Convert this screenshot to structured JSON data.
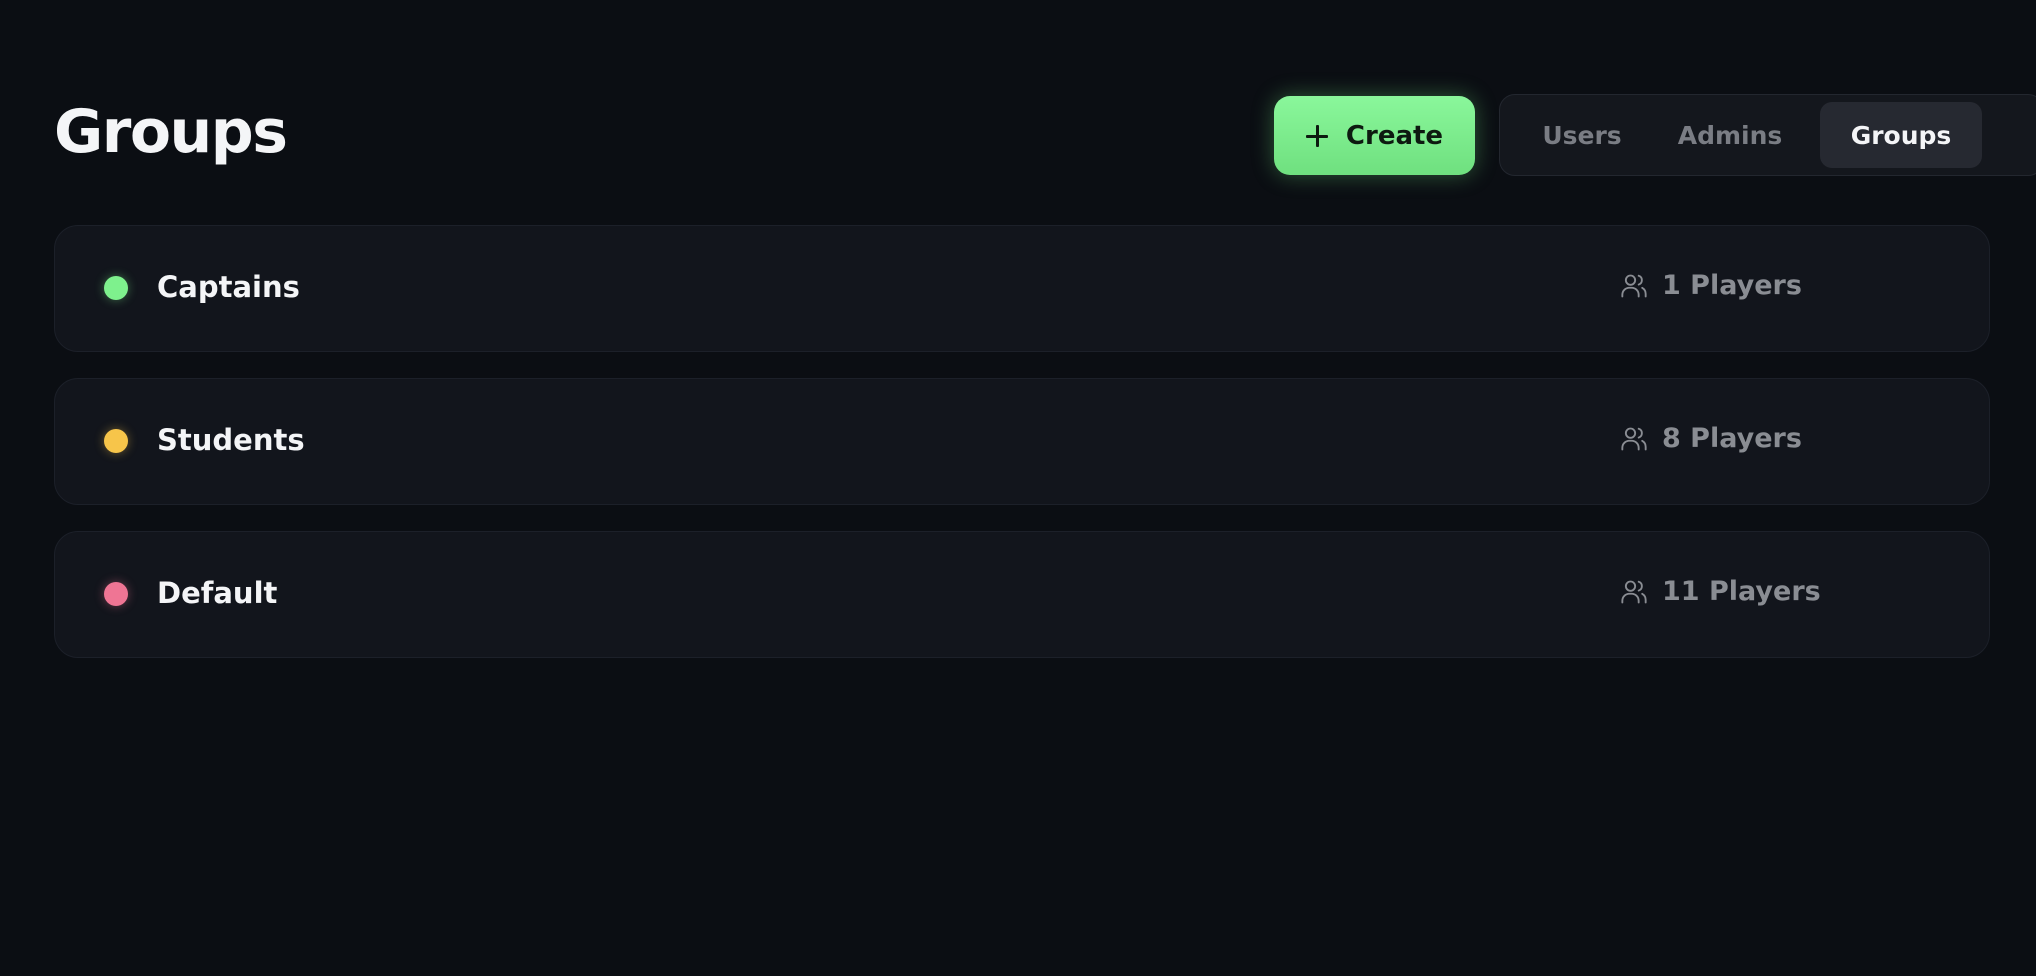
{
  "header": {
    "title": "Groups",
    "create_label": "Create"
  },
  "tabs": [
    {
      "label": "Users",
      "active": false
    },
    {
      "label": "Admins",
      "active": false
    },
    {
      "label": "Groups",
      "active": true
    }
  ],
  "groups": [
    {
      "name": "Captains",
      "color": "#7ef18d",
      "players": "1 Players"
    },
    {
      "name": "Students",
      "color": "#f7c54a",
      "players": "8 Players"
    },
    {
      "name": "Default",
      "color": "#ef7594",
      "players": "11 Players"
    }
  ],
  "icons": {
    "create": "plus-icon",
    "players": "users-icon"
  },
  "colors": {
    "background": "#0b0e13",
    "accent": "#7ef18d"
  }
}
